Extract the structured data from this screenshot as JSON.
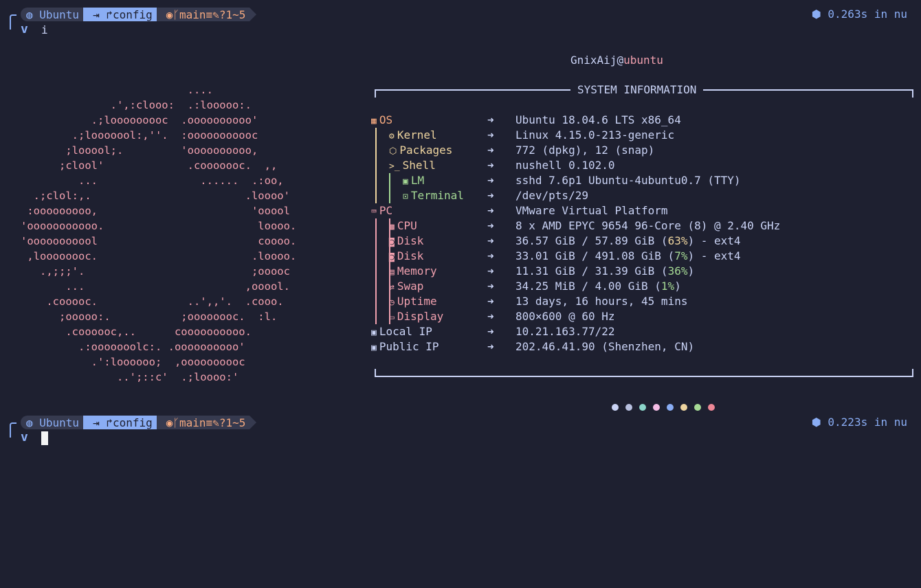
{
  "prompt1": {
    "os": "Ubuntu",
    "dir": "config",
    "branch": "main",
    "status1": "≡",
    "status2": "?1",
    "status3": "~5",
    "timing": "0.263s in nu",
    "command": "i"
  },
  "prompt2": {
    "os": "Ubuntu",
    "dir": "config",
    "branch": "main",
    "status1": "≡",
    "status2": "?1",
    "status3": "~5",
    "timing": "0.223s in nu"
  },
  "user": {
    "name": "GnixAij",
    "at": "@",
    "host": "ubuntu"
  },
  "section_title": "SYSTEM INFORMATION",
  "logo_lines": [
    "                          ....",
    "              .',:clooo:  .:looooo:.",
    "           .;looooooooc  .oooooooooo'",
    "        .;looooool:,''.  :ooooooooooc",
    "       ;looool;.         'oooooooooo,",
    "      ;clool'             .cooooooc.  ,,",
    "         ...                ......  .:oo,",
    "  .;clol:,.                        .loooo'",
    " :ooooooooo,                        'ooool",
    "'ooooooooooo.                        loooo.",
    "'ooooooooool                         coooo.",
    " ,loooooooc.                        .loooo.",
    "   .,;;;'.                          ;ooooc",
    "       ...                         ,ooool.",
    "    .cooooc.              ..',,'.  .cooo.",
    "      ;ooooo:.           ;oooooooc.  :l.",
    "       .coooooc,..      coooooooooo.",
    "         .:ooooooolc:. .oooooooooo'",
    "           .':loooooo;  ,oooooooooc",
    "               ..';::c'  .;loooo:'"
  ],
  "rows": [
    {
      "label": "OS",
      "arrow": "➜",
      "value": "Ubuntu 18.04.6 LTS x86_64",
      "color": "#f5a97f",
      "icon": "windows-icon"
    },
    {
      "label": "Kernel",
      "arrow": "➜",
      "value": "Linux 4.15.0-213-generic",
      "color": "#eed49f",
      "icon": "gear-icon"
    },
    {
      "label": "Packages",
      "arrow": "➜",
      "value": "772 (dpkg), 12 (snap)",
      "color": "#eed49f",
      "icon": "package-icon"
    },
    {
      "label": "Shell",
      "arrow": "➜",
      "value": "nushell 0.102.0",
      "color": "#eed49f",
      "icon": "terminal-prompt-icon"
    },
    {
      "label": "LM",
      "arrow": "➜",
      "value": "sshd 7.6p1 Ubuntu-4ubuntu0.7 (TTY)",
      "color": "#a6da95",
      "icon": "monitor-icon"
    },
    {
      "label": "Terminal",
      "arrow": "➜",
      "value": "/dev/pts/29",
      "color": "#a6da95",
      "icon": "terminal-icon"
    },
    {
      "label": "PC",
      "arrow": "➜",
      "value": "VMware Virtual Platform",
      "color": "#f0a0ae",
      "icon": "laptop-icon"
    },
    {
      "label": "CPU",
      "arrow": "➜",
      "value": "8 x AMD EPYC 9654 96-Core (8) @ 2.40 GHz",
      "color": "#f0a0ae",
      "icon": "cpu-icon"
    },
    {
      "label": "Disk",
      "arrow": "➜",
      "value_pre": "36.57 GiB / 57.89 GiB (",
      "pct": "63%",
      "pct_color": "#eed49f",
      "value_post": ") - ext4",
      "color": "#f0a0ae",
      "icon": "disk-icon"
    },
    {
      "label": "Disk",
      "arrow": "➜",
      "value_pre": "33.01 GiB / 491.08 GiB (",
      "pct": "7%",
      "pct_color": "#a6da95",
      "value_post": ") - ext4",
      "color": "#f0a0ae",
      "icon": "disk-icon"
    },
    {
      "label": "Memory",
      "arrow": "➜",
      "value_pre": "11.31 GiB / 31.39 GiB (",
      "pct": "36%",
      "pct_color": "#a6da95",
      "value_post": ")",
      "color": "#f0a0ae",
      "icon": "memory-icon"
    },
    {
      "label": "Swap",
      "arrow": "➜",
      "value_pre": "34.25 MiB / 4.00 GiB (",
      "pct": "1%",
      "pct_color": "#a6da95",
      "value_post": ")",
      "color": "#f0a0ae",
      "icon": "swap-icon"
    },
    {
      "label": "Uptime",
      "arrow": "➜",
      "value": "13 days, 16 hours, 45 mins",
      "color": "#f0a0ae",
      "icon": "clock-icon"
    },
    {
      "label": "Display",
      "arrow": "➜",
      "value": "800×600 @ 60 Hz",
      "color": "#f0a0ae",
      "icon": "display-icon"
    },
    {
      "label": "Local IP",
      "arrow": "➜",
      "value": "10.21.163.77/22",
      "color": "#cad3f5",
      "icon": "ip-icon"
    },
    {
      "label": "Public IP",
      "arrow": "➜",
      "value": "202.46.41.90 (Shenzhen, CN)",
      "color": "#cad3f5",
      "icon": "ip-icon"
    }
  ],
  "palette": [
    "#cad3f5",
    "#b8c0e0",
    "#8bd5ca",
    "#f5bde6",
    "#8aadf4",
    "#eed49f",
    "#a6da95",
    "#ed8796"
  ]
}
